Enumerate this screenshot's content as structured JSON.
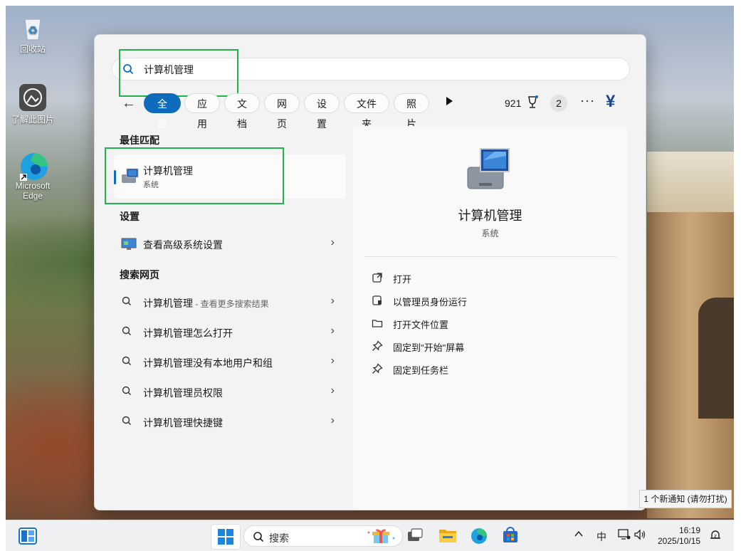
{
  "desktop": {
    "icons": [
      {
        "label": "回收站",
        "icon": "recycle-bin-icon"
      },
      {
        "label": "了解此图片",
        "icon": "learn-about-picture-icon"
      },
      {
        "label": "Microsoft Edge",
        "icon": "edge-icon"
      }
    ]
  },
  "search": {
    "query": "计算机管理",
    "filters": [
      "全部",
      "应用",
      "文档",
      "网页",
      "设置",
      "文件夹",
      "照片"
    ],
    "active_filter": "全部",
    "points": "921",
    "badge_count": "2",
    "more_label": "···",
    "currency_symbol": "¥"
  },
  "best_match": {
    "section_title": "最佳匹配",
    "name": "计算机管理",
    "subtitle": "系统"
  },
  "settings": {
    "section_title": "设置",
    "items": [
      {
        "label": "查看高级系统设置"
      }
    ]
  },
  "web": {
    "section_title": "搜索网页",
    "items": [
      {
        "label": "计算机管理",
        "hint": " - 查看更多搜索结果"
      },
      {
        "label": "计算机管理怎么打开",
        "hint": ""
      },
      {
        "label": "计算机管理没有本地用户和组",
        "hint": ""
      },
      {
        "label": "计算机管理员权限",
        "hint": ""
      },
      {
        "label": "计算机管理快捷键",
        "hint": ""
      }
    ]
  },
  "preview": {
    "title": "计算机管理",
    "subtitle": "系统",
    "actions": [
      {
        "label": "打开",
        "icon": "open-external-icon"
      },
      {
        "label": "以管理员身份运行",
        "icon": "run-as-admin-icon"
      },
      {
        "label": "打开文件位置",
        "icon": "folder-icon"
      },
      {
        "label": "固定到\"开始\"屏幕",
        "icon": "pin-icon"
      },
      {
        "label": "固定到任务栏",
        "icon": "pin-icon"
      }
    ]
  },
  "toast": {
    "text": "1 个新通知 (请勿打扰)"
  },
  "taskbar": {
    "search_placeholder": "搜索",
    "tray": {
      "input_method": "中",
      "time": "16:19",
      "date": "2025/10/15"
    }
  },
  "colors": {
    "accent": "#0f6cbd",
    "highlight_box": "#22b14c"
  }
}
